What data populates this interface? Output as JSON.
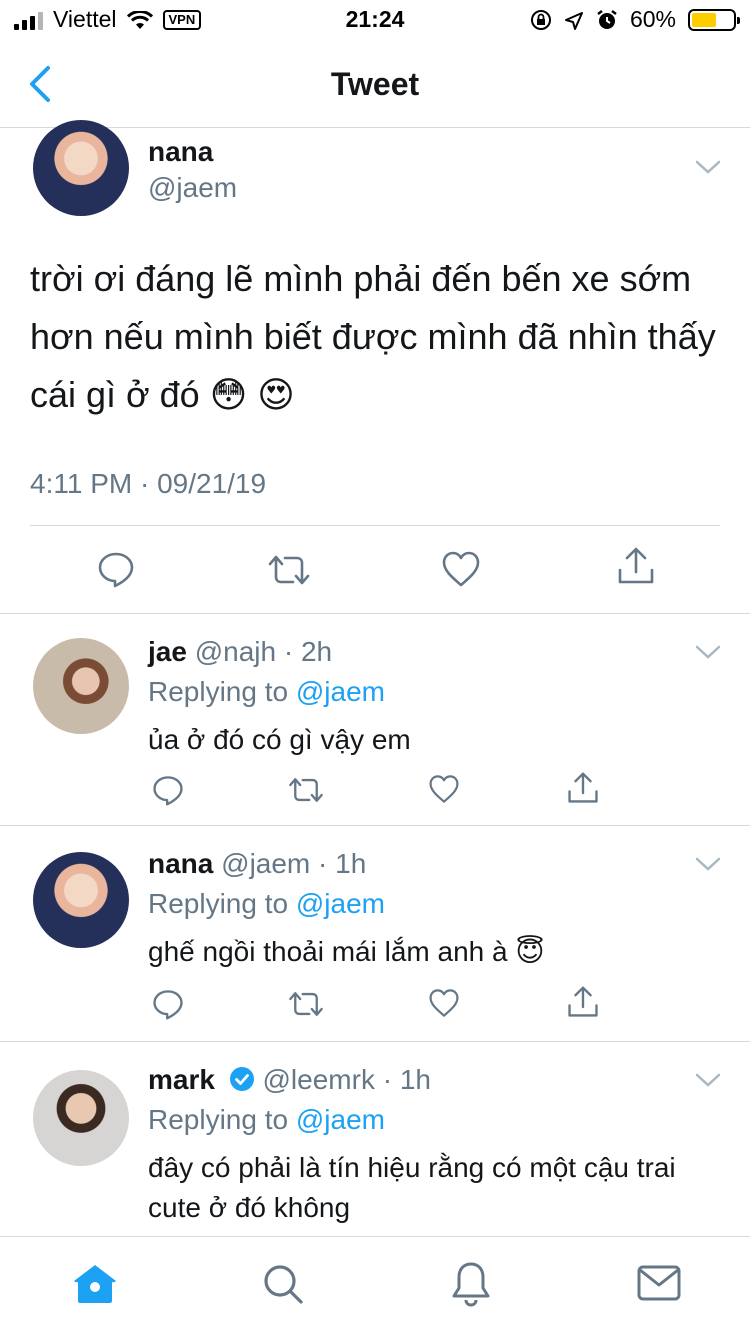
{
  "status": {
    "carrier": "Viettel",
    "vpn": "VPN",
    "time": "21:24",
    "battery": "60%",
    "battery_level": 0.6,
    "battery_color": "#ffcc00"
  },
  "nav": {
    "title": "Tweet"
  },
  "main_tweet": {
    "name": "nana",
    "handle": "@jaem",
    "text": "trời ơi đáng lẽ mình phải đến bến xe sớm hơn nếu mình biết được mình đã nhìn thấy cái gì ở đó 😳 😍",
    "timestamp": "4:11 PM · 09/21/19"
  },
  "replies": [
    {
      "name": "jae",
      "meta": "@najh · 2h",
      "replying_prefix": "Replying to ",
      "replying_to": "@jaem",
      "text": "ủa ở đó có gì vậy em"
    },
    {
      "name": "nana",
      "meta": "@jaem · 1h",
      "replying_prefix": "Replying to ",
      "replying_to": "@jaem",
      "text": "ghế ngồi thoải mái lắm anh à 😇"
    },
    {
      "name": "mark",
      "meta": "@leemrk · 1h",
      "replying_prefix": "Replying to ",
      "replying_to": "@jaem",
      "text": "đây có phải là tín hiệu rằng có một cậu trai cute ở đó không"
    }
  ],
  "colors": {
    "accent": "#1da1f2",
    "secondary_text": "#657786",
    "divider": "#d6d9db"
  }
}
